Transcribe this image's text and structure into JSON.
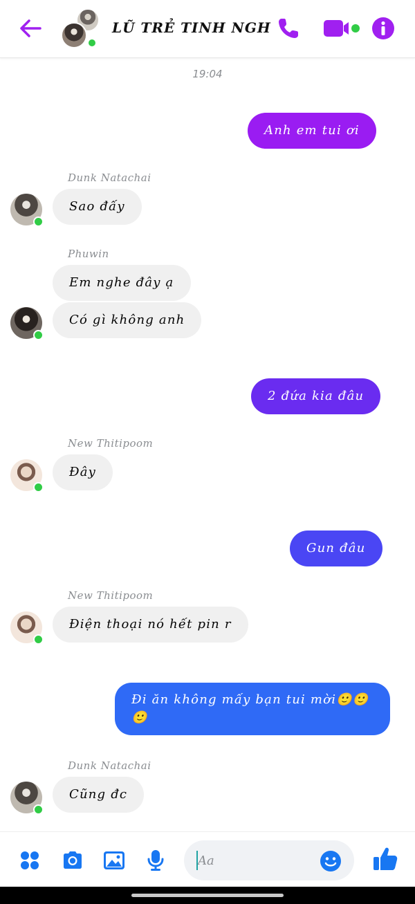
{
  "header": {
    "title": "LŨ TRẺ TINH NGH",
    "accent": "#a020f0"
  },
  "conversation": {
    "timestamp": "19:04",
    "messages": [
      {
        "id": "m1",
        "direction": "out",
        "text": "Anh em tui ơi",
        "color": "#9a1cf2"
      },
      {
        "id": "m2",
        "direction": "in",
        "sender": "Dunk Natachai",
        "text": "Sao đấy"
      },
      {
        "id": "m3",
        "direction": "in",
        "sender": "Phuwin",
        "text": "Em nghe đây ạ"
      },
      {
        "id": "m4",
        "direction": "in",
        "text": "Có gì không anh"
      },
      {
        "id": "m5",
        "direction": "out",
        "text": "2 đứa kia đâu",
        "color": "#6a2cf0"
      },
      {
        "id": "m6",
        "direction": "in",
        "sender": "New Thitipoom",
        "text": "Đây"
      },
      {
        "id": "m7",
        "direction": "out",
        "text": "Gun đâu",
        "color": "#4a46f4"
      },
      {
        "id": "m8",
        "direction": "in",
        "sender": "New Thitipoom",
        "text": "Điện thoại nó hết pin r"
      },
      {
        "id": "m9",
        "direction": "out",
        "text": "Đi ăn không mấy bạn tui mời🙂🙂🙂",
        "color": "#2f6af6"
      },
      {
        "id": "m10",
        "direction": "in",
        "sender": "Dunk Natachai",
        "text": "Cũng đc"
      }
    ]
  },
  "composer": {
    "placeholder": "Aa",
    "value": ""
  },
  "icons": {
    "back": "arrow-left-icon",
    "call": "phone-icon",
    "video": "video-camera-icon",
    "info": "info-icon",
    "apps": "four-dots-icon",
    "camera": "camera-icon",
    "gallery": "image-icon",
    "mic": "microphone-icon",
    "emoji": "smiley-icon",
    "like": "thumbs-up-icon"
  },
  "colors": {
    "accent": "#a020f0",
    "footer_icon": "#1877f2",
    "incoming_bubble": "#f0f0f0",
    "online": "#31cc46"
  }
}
